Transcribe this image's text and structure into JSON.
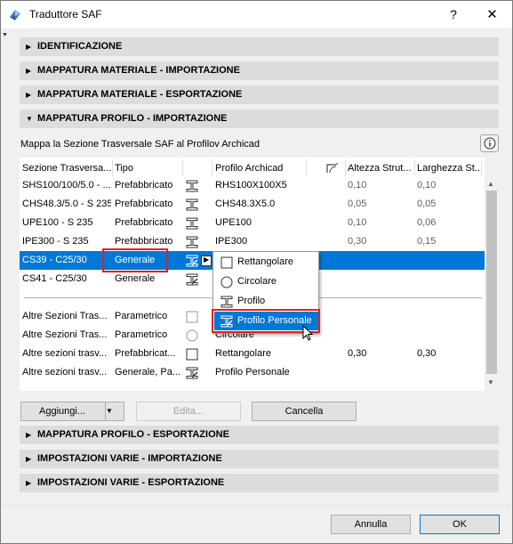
{
  "window": {
    "title": "Traduttore SAF",
    "help": "?",
    "close": "✕"
  },
  "sections_top": [
    {
      "label": "IDENTIFICAZIONE",
      "expanded": false
    },
    {
      "label": "MAPPATURA MATERIALE - IMPORTAZIONE",
      "expanded": false
    },
    {
      "label": "MAPPATURA MATERIALE - ESPORTAZIONE",
      "expanded": false
    },
    {
      "label": "MAPPATURA PROFILO - IMPORTAZIONE",
      "expanded": true
    }
  ],
  "mapping": {
    "description": "Mappa la Sezione Trasversale SAF al Profilov Archicad",
    "columns": [
      "Sezione Trasversa...",
      "Tipo",
      "Profilo Archicad",
      "Altezza Strut...",
      "Larghezza St..."
    ],
    "rows": [
      {
        "section": "SHS100/100/5.0 - ...",
        "type": "Prefabbricato",
        "icon": "i-beam-icon",
        "profile": "RHS100X100X5",
        "height": "0,10",
        "width": "0,10",
        "selected": false
      },
      {
        "section": "CHS48.3/5.0 - S 235",
        "type": "Prefabbricato",
        "icon": "i-beam-icon",
        "profile": "CHS48.3X5.0",
        "height": "0,05",
        "width": "0,05",
        "selected": false
      },
      {
        "section": "UPE100 - S 235",
        "type": "Prefabbricato",
        "icon": "i-beam-icon",
        "profile": "UPE100",
        "height": "0,10",
        "width": "0,06",
        "selected": false
      },
      {
        "section": "IPE300 - S 235",
        "type": "Prefabbricato",
        "icon": "i-beam-icon",
        "profile": "IPE300",
        "height": "0,30",
        "width": "0,15",
        "selected": false
      },
      {
        "section": "CS39 - C25/30",
        "type": "Generale",
        "icon": "custom-profile-icon",
        "profile": "",
        "height": "",
        "width": "",
        "selected": true
      },
      {
        "section": "CS41 - C25/30",
        "type": "Generale",
        "icon": "custom-profile-icon",
        "profile": "",
        "height": "",
        "width": "",
        "selected": false
      }
    ],
    "other_rows": [
      {
        "section": "Altre Sezioni Tras...",
        "type": "Parametrico",
        "icon": "rectangle-icon",
        "profile": "",
        "height": "",
        "width": ""
      },
      {
        "section": "Altre Sezioni Tras...",
        "type": "Parametrico",
        "icon": "circle-icon",
        "profile": "Circolare",
        "height": "",
        "width": ""
      },
      {
        "section": "Altre sezioni trasv...",
        "type": "Prefabbricat...",
        "icon": "rectangle-icon",
        "profile": "Rettangolare",
        "height": "0,30",
        "width": "0,30"
      },
      {
        "section": "Altre sezioni trasv...",
        "type": "Generale, Pa...",
        "icon": "custom-profile-icon",
        "profile": "Profilo Personale",
        "height": "",
        "width": ""
      }
    ]
  },
  "popup": {
    "items": [
      {
        "label": "Rettangolare",
        "icon": "rectangle-icon",
        "highlighted": false
      },
      {
        "label": "Circolare",
        "icon": "circle-icon",
        "highlighted": false
      },
      {
        "label": "Profilo",
        "icon": "i-beam-icon",
        "highlighted": false
      },
      {
        "label": "Profilo Personale",
        "icon": "custom-profile-icon",
        "highlighted": true
      }
    ]
  },
  "buttons": {
    "add": "Aggiungi...",
    "edit": "Edita...",
    "delete": "Cancella",
    "cancel": "Annulla",
    "ok": "OK"
  },
  "sections_bottom": [
    {
      "label": "MAPPATURA PROFILO - ESPORTAZIONE",
      "expanded": false
    },
    {
      "label": "IMPOSTAZIONI VARIE - IMPORTAZIONE",
      "expanded": false
    },
    {
      "label": "IMPOSTAZIONI VARIE - ESPORTAZIONE",
      "expanded": false
    }
  ],
  "colors": {
    "selection": "#0078d7",
    "highlight_box": "#e02020",
    "section_bg": "#dcdcdc"
  }
}
